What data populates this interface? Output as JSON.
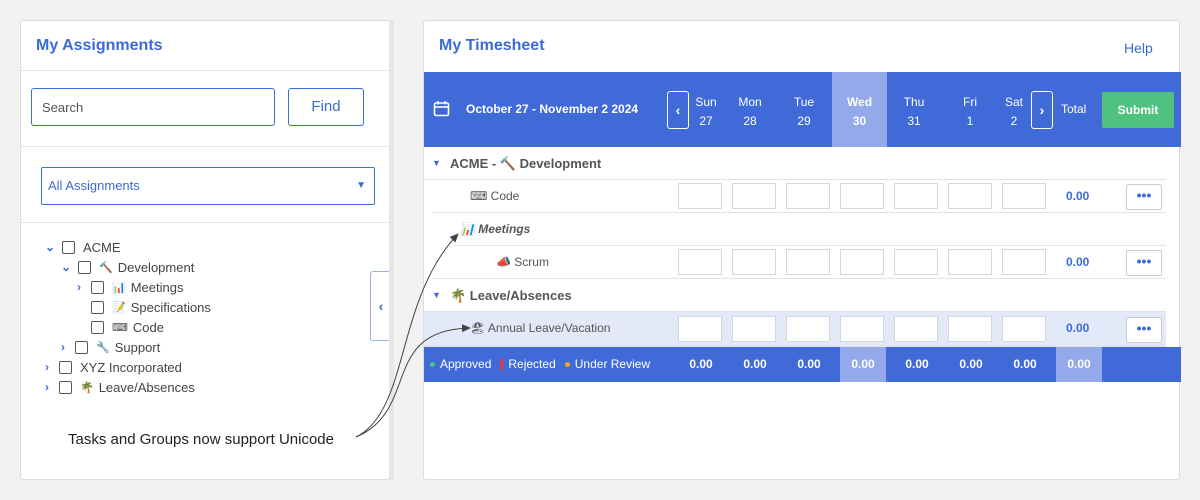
{
  "left": {
    "title": "My Assignments",
    "search_placeholder": "Search",
    "find_label": "Find",
    "filter_value": "All Assignments",
    "tree": [
      {
        "label": "ACME",
        "chevron": "⌄"
      },
      {
        "label": "Development",
        "chevron": "⌄",
        "emoji": "🔨"
      },
      {
        "label": "Meetings",
        "chevron": "›",
        "emoji": "📊"
      },
      {
        "label": "Specifications",
        "emoji": "📝"
      },
      {
        "label": "Code",
        "emoji": "⌨"
      },
      {
        "label": "Support",
        "chevron": "›",
        "emoji": "🔧"
      },
      {
        "label": "XYZ Incorporated",
        "chevron": "›"
      },
      {
        "label": "Leave/Absences",
        "chevron": "›",
        "emoji": "🌴"
      }
    ],
    "note": "Tasks and Groups now support Unicode"
  },
  "right": {
    "title": "My Timesheet",
    "help": "Help",
    "date_range": "October 27 - November 2 2024",
    "days": [
      {
        "name": "Sun",
        "num": "27"
      },
      {
        "name": "Mon",
        "num": "28"
      },
      {
        "name": "Tue",
        "num": "29"
      },
      {
        "name": "Wed",
        "num": "30"
      },
      {
        "name": "Thu",
        "num": "31"
      },
      {
        "name": "Fri",
        "num": "1"
      },
      {
        "name": "Sat",
        "num": "2"
      }
    ],
    "today_index": 3,
    "total_label": "Total",
    "submit_label": "Submit",
    "rows": {
      "acme_group": "ACME - 🔨 Development",
      "code": "⌨ Code",
      "code_total": "0.00",
      "meetings": "📊 Meetings",
      "scrum": "📣 Scrum",
      "scrum_total": "0.00",
      "leave_group": "🌴 Leave/Absences",
      "annual": "🏖 Annual Leave/Vacation",
      "annual_total": "0.00"
    },
    "more_label": "•••",
    "legend": {
      "approved": "Approved",
      "rejected": "Rejected",
      "review": "Under Review"
    },
    "footer_totals": [
      "0.00",
      "0.00",
      "0.00",
      "0.00",
      "0.00",
      "0.00",
      "0.00",
      "0.00"
    ]
  },
  "colors": {
    "accent": "#3f6ad8",
    "submit": "#50c27f",
    "approved": "#50c27f",
    "rejected": "#e23b3b",
    "review": "#f5a623"
  }
}
